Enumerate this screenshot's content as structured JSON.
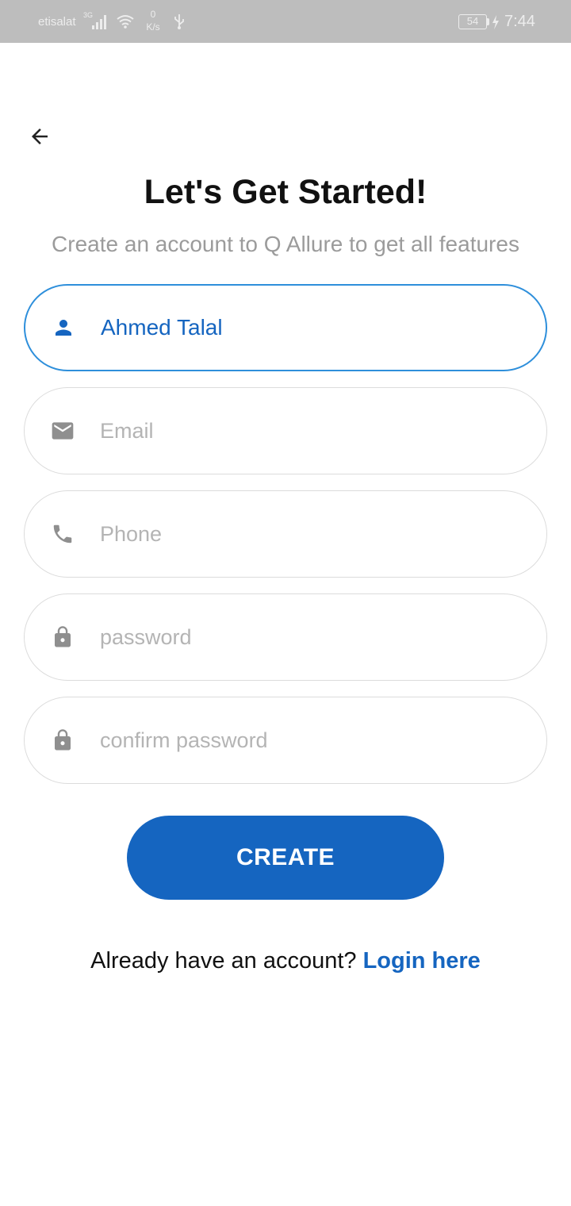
{
  "status_bar": {
    "carrier": "etisalat",
    "network_type": "3G",
    "speed_value": "0",
    "speed_unit": "K/s",
    "battery": "54",
    "time": "7:44"
  },
  "header": {
    "title": "Let's Get Started!",
    "subtitle": "Create an account to Q Allure to get all features"
  },
  "form": {
    "name": {
      "value": "Ahmed Talal",
      "placeholder": ""
    },
    "email": {
      "value": "",
      "placeholder": "Email"
    },
    "phone": {
      "value": "",
      "placeholder": "Phone"
    },
    "password": {
      "value": "",
      "placeholder": "password"
    },
    "confirm_password": {
      "value": "",
      "placeholder": "confirm password"
    }
  },
  "actions": {
    "create_label": "CREATE"
  },
  "footer": {
    "prompt": "Already have an account?",
    "login_link": "Login here"
  },
  "colors": {
    "primary": "#1565c0",
    "active_border": "#2e8fdb",
    "placeholder": "#b4b4b4",
    "status_bar": "#bdbdbd"
  }
}
